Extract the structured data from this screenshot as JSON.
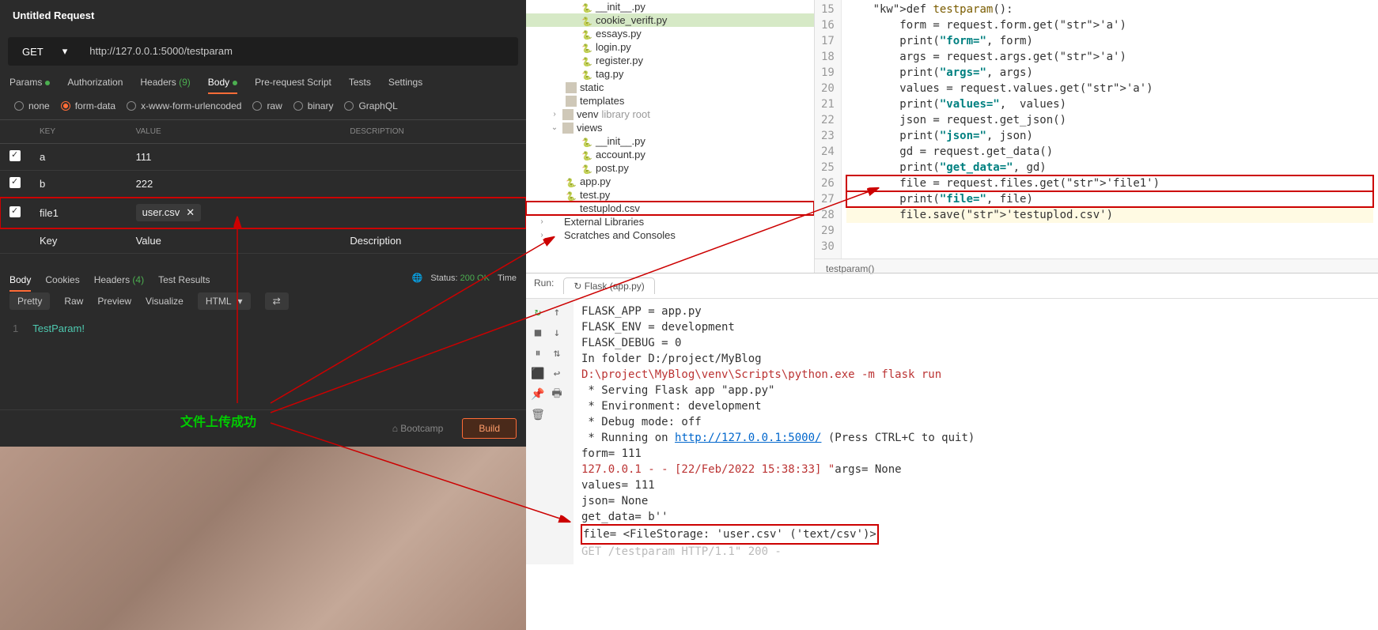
{
  "postman": {
    "title": "Untitled Request",
    "method": "GET",
    "url": "http://127.0.0.1:5000/testparam",
    "tabs": [
      "Params",
      "Authorization",
      "Headers",
      "Body",
      "Pre-request Script",
      "Tests",
      "Settings"
    ],
    "headers_count": "(9)",
    "body_types": [
      "none",
      "form-data",
      "x-www-form-urlencoded",
      "raw",
      "binary",
      "GraphQL"
    ],
    "body_active": "form-data",
    "th_key": "KEY",
    "th_value": "VALUE",
    "th_desc": "DESCRIPTION",
    "rows": [
      {
        "key": "a",
        "value": "111"
      },
      {
        "key": "b",
        "value": "222"
      },
      {
        "key": "file1",
        "value": "user.csv",
        "is_file": true
      }
    ],
    "ph_key": "Key",
    "ph_value": "Value",
    "ph_desc": "Description",
    "resp_tabs": [
      "Body",
      "Cookies",
      "Headers",
      "Test Results"
    ],
    "resp_headers_count": "(4)",
    "status_label": "Status:",
    "status_value": "200 OK",
    "time_label": "Time",
    "views": [
      "Pretty",
      "Raw",
      "Preview",
      "Visualize"
    ],
    "lang": "HTML",
    "resp_line": "1",
    "resp_body": "TestParam!",
    "bootcamp": "⌂ Bootcamp",
    "build": "Build"
  },
  "tree": {
    "items": [
      {
        "indent": 70,
        "icon": "py",
        "label": "__init__.py"
      },
      {
        "indent": 70,
        "icon": "py",
        "label": "cookie_verift.py",
        "hl": true
      },
      {
        "indent": 70,
        "icon": "py",
        "label": "essays.py"
      },
      {
        "indent": 70,
        "icon": "py",
        "label": "login.py"
      },
      {
        "indent": 70,
        "icon": "py",
        "label": "register.py"
      },
      {
        "indent": 70,
        "icon": "py",
        "label": "tag.py"
      },
      {
        "indent": 50,
        "icon": "dir",
        "label": "static"
      },
      {
        "indent": 50,
        "icon": "dir",
        "label": "templates"
      },
      {
        "indent": 30,
        "chev": ">",
        "icon": "dir",
        "label": "venv",
        "suffix": "library root"
      },
      {
        "indent": 30,
        "chev": "v",
        "icon": "dir",
        "label": "views"
      },
      {
        "indent": 70,
        "icon": "py",
        "label": "__init__.py"
      },
      {
        "indent": 70,
        "icon": "py",
        "label": "account.py"
      },
      {
        "indent": 70,
        "icon": "py",
        "label": "post.py"
      },
      {
        "indent": 50,
        "icon": "py",
        "label": "app.py"
      },
      {
        "indent": 50,
        "icon": "py",
        "label": "test.py"
      },
      {
        "indent": 50,
        "icon": "csv",
        "label": "testuplod.csv",
        "box": true
      },
      {
        "indent": 14,
        "chev": ">",
        "icon": "lib",
        "label": "External Libraries"
      },
      {
        "indent": 14,
        "chev": ">",
        "icon": "lib",
        "label": "Scratches and Consoles"
      }
    ]
  },
  "code": {
    "start": 15,
    "lines": [
      "def testparam():",
      "    form = request.form.get('a')",
      "    print(\"form=\", form)",
      "    args = request.args.get('a')",
      "    print(\"args=\", args)",
      "    values = request.values.get('a')",
      "    print(\"values=\",  values)",
      "    json = request.get_json()",
      "    print(\"json=\", json)",
      "    gd = request.get_data()",
      "    print(\"get_data=\", gd)",
      "    file = request.files.get('file1')",
      "    print(\"file=\", file)",
      "    file.save('testuplod.csv')",
      "",
      ""
    ],
    "crumb": "testparam()"
  },
  "run": {
    "label": "Run:",
    "tab": "Flask (app.py)",
    "lines": [
      {
        "t": "FLASK_APP = app.py"
      },
      {
        "t": "FLASK_ENV = development"
      },
      {
        "t": "FLASK_DEBUG = 0"
      },
      {
        "t": "In folder D:/project/MyBlog"
      },
      {
        "t": "D:\\project\\MyBlog\\venv\\Scripts\\python.exe -m flask run",
        "red": true
      },
      {
        "t": " * Serving Flask app \"app.py\""
      },
      {
        "t": " * Environment: development"
      },
      {
        "t": " * Debug mode: off"
      },
      {
        "pre": " * Running on ",
        "link": "http://127.0.0.1:5000/",
        "post": " (Press CTRL+C to quit)"
      },
      {
        "t": "form= 111"
      },
      {
        "pre": "127.0.0.1 - - [22/Feb/2022 15:38:33] \"",
        "post": "args= None",
        "red": true,
        "split": true
      },
      {
        "t": "values= 111"
      },
      {
        "t": "json= None"
      },
      {
        "t": "get_data= b''"
      },
      {
        "t": "file= <FileStorage: 'user.csv' ('text/csv')>",
        "box": true
      },
      {
        "t": "GET /testparam HTTP/1.1\" 200 -",
        "faint": true
      }
    ]
  },
  "annotation": "文件上传成功"
}
